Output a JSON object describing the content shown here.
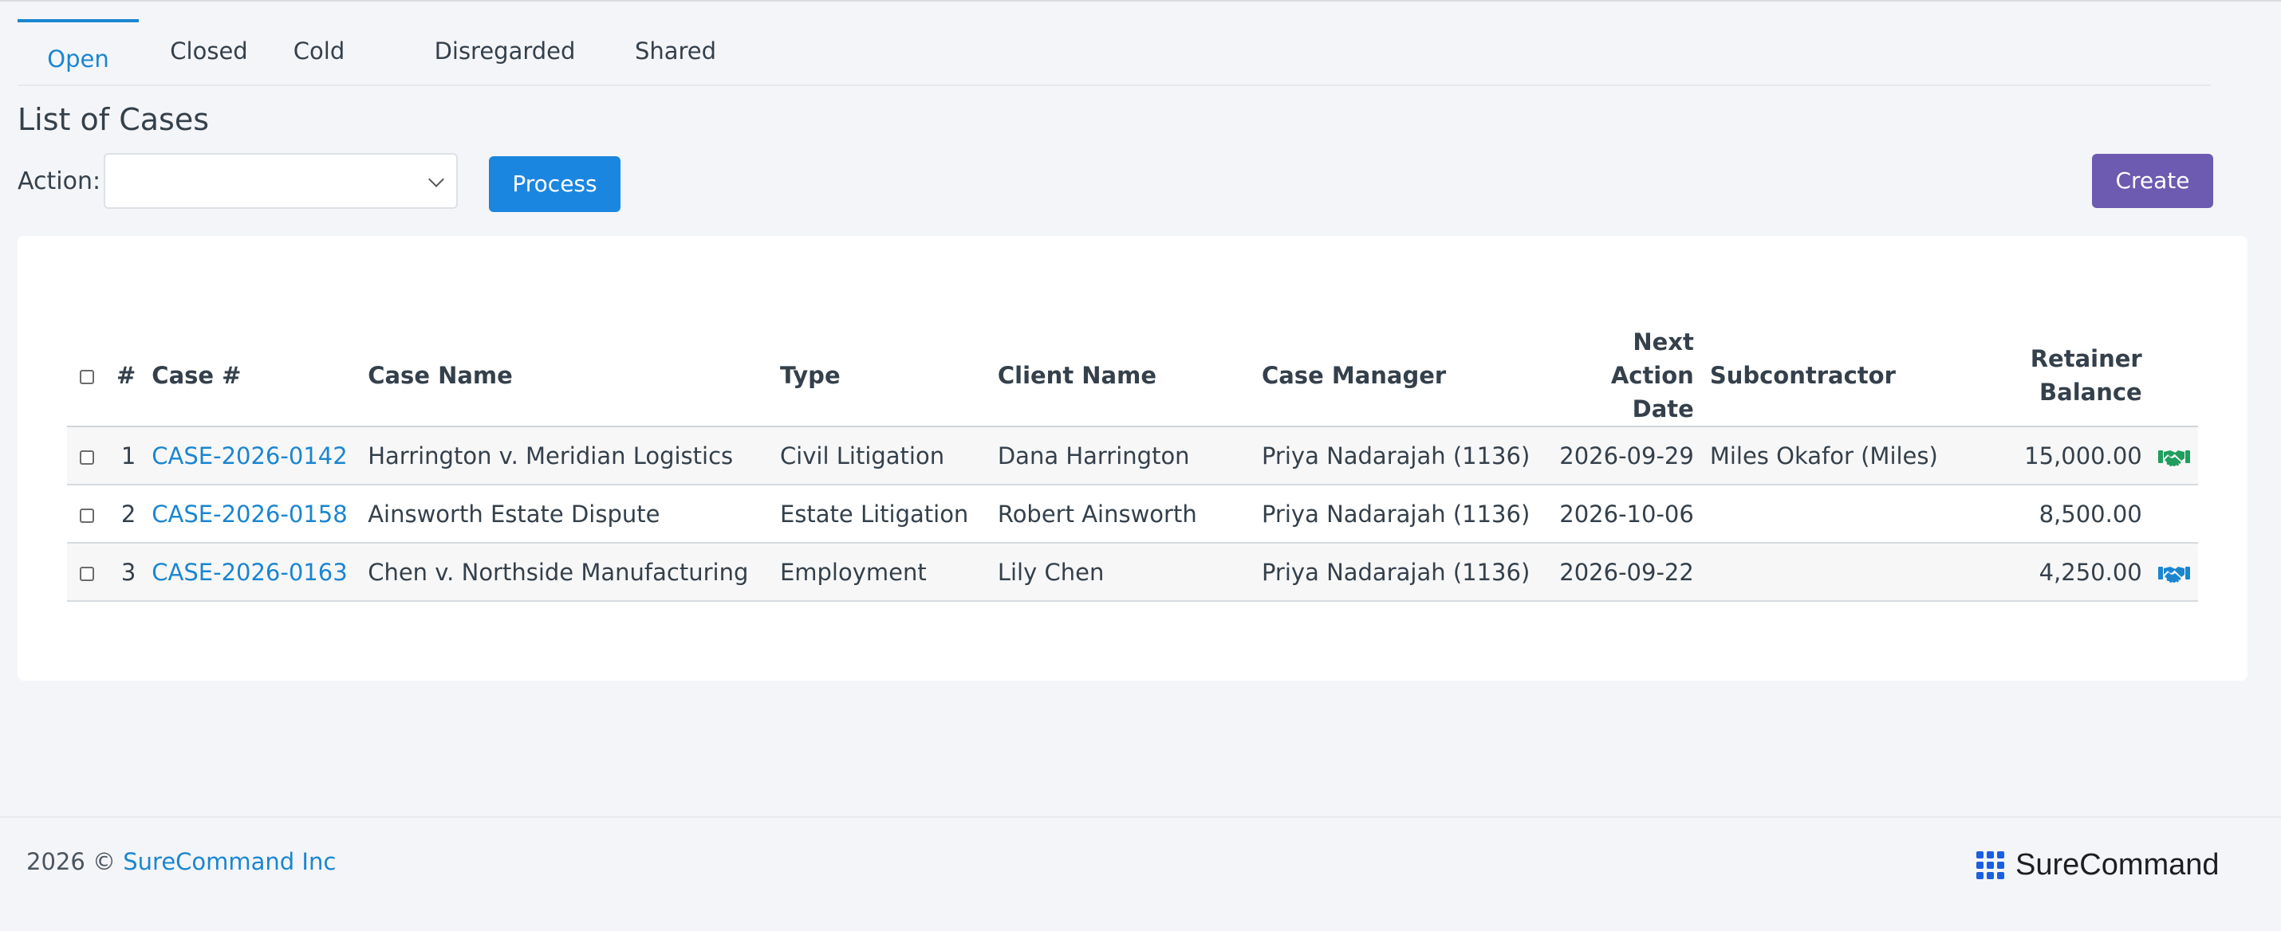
{
  "tabs": [
    {
      "label": "Open",
      "active": true
    },
    {
      "label": "Closed",
      "active": false
    },
    {
      "label": "Cold",
      "active": false
    },
    {
      "label": "Disregarded",
      "active": false
    },
    {
      "label": "Shared",
      "active": false
    }
  ],
  "page_title": "List of Cases",
  "action_bar": {
    "label": "Action:",
    "selected_value": "",
    "process_label": "Process",
    "create_label": "Create"
  },
  "table": {
    "headers": {
      "num": "#",
      "case_no": "Case #",
      "case_name": "Case Name",
      "type": "Type",
      "client_name": "Client Name",
      "case_manager": "Case Manager",
      "next_action_1": "Next Action",
      "next_action_2": "Date",
      "subcontractor": "Subcontractor",
      "retainer_1": "Retainer",
      "retainer_2": "Balance"
    },
    "rows": [
      {
        "num": "1",
        "case_no": "CASE-2026-0142",
        "case_name": "Harrington v. Meridian Logistics",
        "type": "Civil Litigation",
        "client_name": "Dana Harrington",
        "case_manager": "Priya Nadarajah (1136)",
        "next_action_date": "2026-09-29",
        "subcontractor": "Miles Okafor (Miles)",
        "retainer_balance": "15,000.00",
        "icon": "handshake-icon",
        "icon_color": "#1f9e5e"
      },
      {
        "num": "2",
        "case_no": "CASE-2026-0158",
        "case_name": "Ainsworth Estate Dispute",
        "type": "Estate Litigation",
        "client_name": "Robert Ainsworth",
        "case_manager": "Priya Nadarajah (1136)",
        "next_action_date": "2026-10-06",
        "subcontractor": "",
        "retainer_balance": "8,500.00",
        "icon": "",
        "icon_color": ""
      },
      {
        "num": "3",
        "case_no": "CASE-2026-0163",
        "case_name": "Chen v. Northside Manufacturing",
        "type": "Employment",
        "client_name": "Lily Chen",
        "case_manager": "Priya Nadarajah (1136)",
        "next_action_date": "2026-09-22",
        "subcontractor": "",
        "retainer_balance": "4,250.00",
        "icon": "handshake-icon",
        "icon_color": "#1a86d0"
      }
    ]
  },
  "footer": {
    "year": "2026 ©",
    "company": "SureCommand Inc",
    "brand": "SureCommand"
  },
  "colors": {
    "accent": "#1a86d0",
    "process_button": "#1a86e0",
    "create_button": "#6c5bb0"
  }
}
